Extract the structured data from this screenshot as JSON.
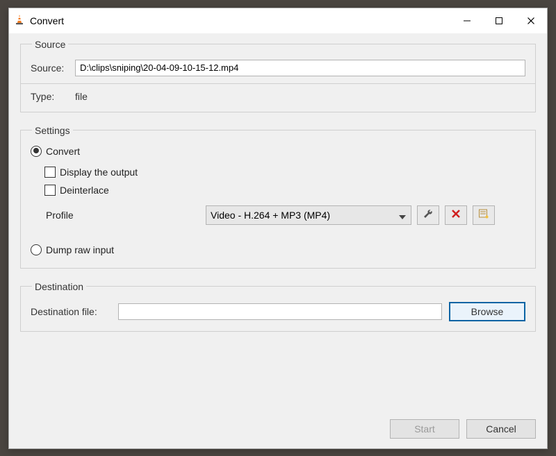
{
  "window": {
    "title": "Convert"
  },
  "source": {
    "legend": "Source",
    "source_label": "Source:",
    "source_value": "D:\\clips\\sniping\\20-04-09-10-15-12.mp4",
    "type_label": "Type:",
    "type_value": "file"
  },
  "settings": {
    "legend": "Settings",
    "convert_label": "Convert",
    "display_output_label": "Display the output",
    "deinterlace_label": "Deinterlace",
    "profile_label": "Profile",
    "profile_value": "Video - H.264 + MP3 (MP4)",
    "dump_raw_label": "Dump raw input"
  },
  "destination": {
    "legend": "Destination",
    "file_label": "Destination file:",
    "file_value": "",
    "browse_label": "Browse"
  },
  "footer": {
    "start_label": "Start",
    "cancel_label": "Cancel"
  }
}
